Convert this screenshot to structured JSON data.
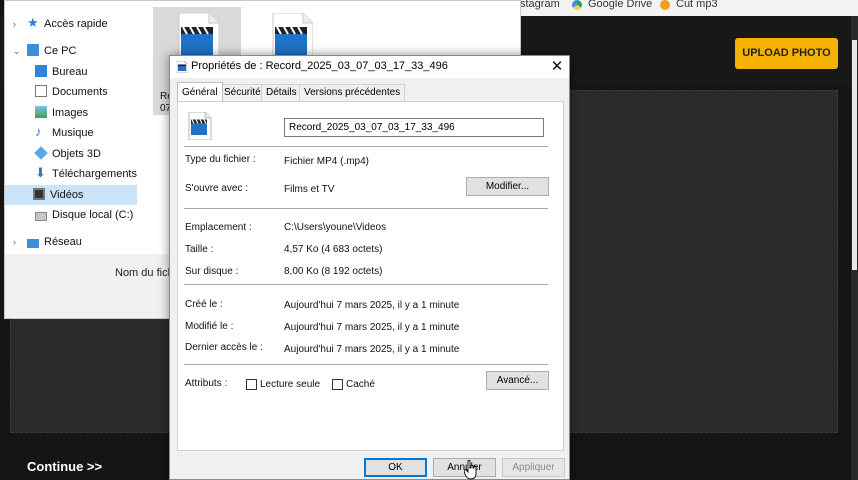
{
  "browser": {
    "bookmarks": [
      {
        "label": "stagram",
        "icon": "instagram-icon"
      },
      {
        "label": "Google Drive",
        "icon": "google-drive-icon"
      },
      {
        "label": "Cut mp3",
        "icon": "cut-mp3-icon"
      }
    ]
  },
  "webpage": {
    "upload_label": "UPLOAD PHOTO",
    "continue_label": "Continue  >>",
    "accent": "#f5b200"
  },
  "explorer": {
    "nav": [
      {
        "label": "Accès rapide",
        "icon": "star-icon"
      },
      {
        "label": "Ce PC",
        "icon": "computer-icon"
      },
      {
        "label": "Bureau",
        "icon": "desktop-folder-icon"
      },
      {
        "label": "Documents",
        "icon": "documents-icon"
      },
      {
        "label": "Images",
        "icon": "images-icon"
      },
      {
        "label": "Musique",
        "icon": "music-icon"
      },
      {
        "label": "Objets 3D",
        "icon": "3d-objects-icon"
      },
      {
        "label": "Téléchargements",
        "icon": "download-icon"
      },
      {
        "label": "Vidéos",
        "icon": "videos-icon"
      },
      {
        "label": "Disque local (C:)",
        "icon": "disk-icon"
      },
      {
        "label": "Réseau",
        "icon": "network-icon"
      }
    ],
    "selected_file_label_line1": "Recor",
    "selected_file_label_line2": "07_0",
    "name_column_partial": "Nom du fich"
  },
  "dialog": {
    "title": "Propriétés de : Record_2025_03_07_03_17_33_496",
    "close_glyph": "✕",
    "tabs": [
      "Général",
      "Sécurité",
      "Détails",
      "Versions précédentes"
    ],
    "file_name": "Record_2025_03_07_03_17_33_496",
    "type_label": "Type du fichier :",
    "type_value": "Fichier MP4 (.mp4)",
    "opens_label": "S'ouvre avec :",
    "opens_value": "Films et TV",
    "modify_label": "Modifier...",
    "location_label": "Emplacement :",
    "location_value": "C:\\Users\\youne\\Videos",
    "size_label": "Taille :",
    "size_value": "4,57 Ko (4 683 octets)",
    "disk_size_label": "Sur disque :",
    "disk_size_value": "8,00 Ko (8 192 octets)",
    "created_label": "Créé le :",
    "created_value": "Aujourd'hui 7 mars 2025, il y a 1 minute",
    "modified_label": "Modifié le :",
    "modified_value": "Aujourd'hui 7 mars 2025, il y a 1 minute",
    "accessed_label": "Dernier accès le :",
    "accessed_value": "Aujourd'hui 7 mars 2025, il y a 1 minute",
    "attributes_label": "Attributs :",
    "readonly_label": "Lecture seule",
    "hidden_label": "Caché",
    "advanced_label": "Avancé...",
    "ok_label": "OK",
    "cancel_label": "Annuler",
    "apply_label": "Appliquer"
  }
}
